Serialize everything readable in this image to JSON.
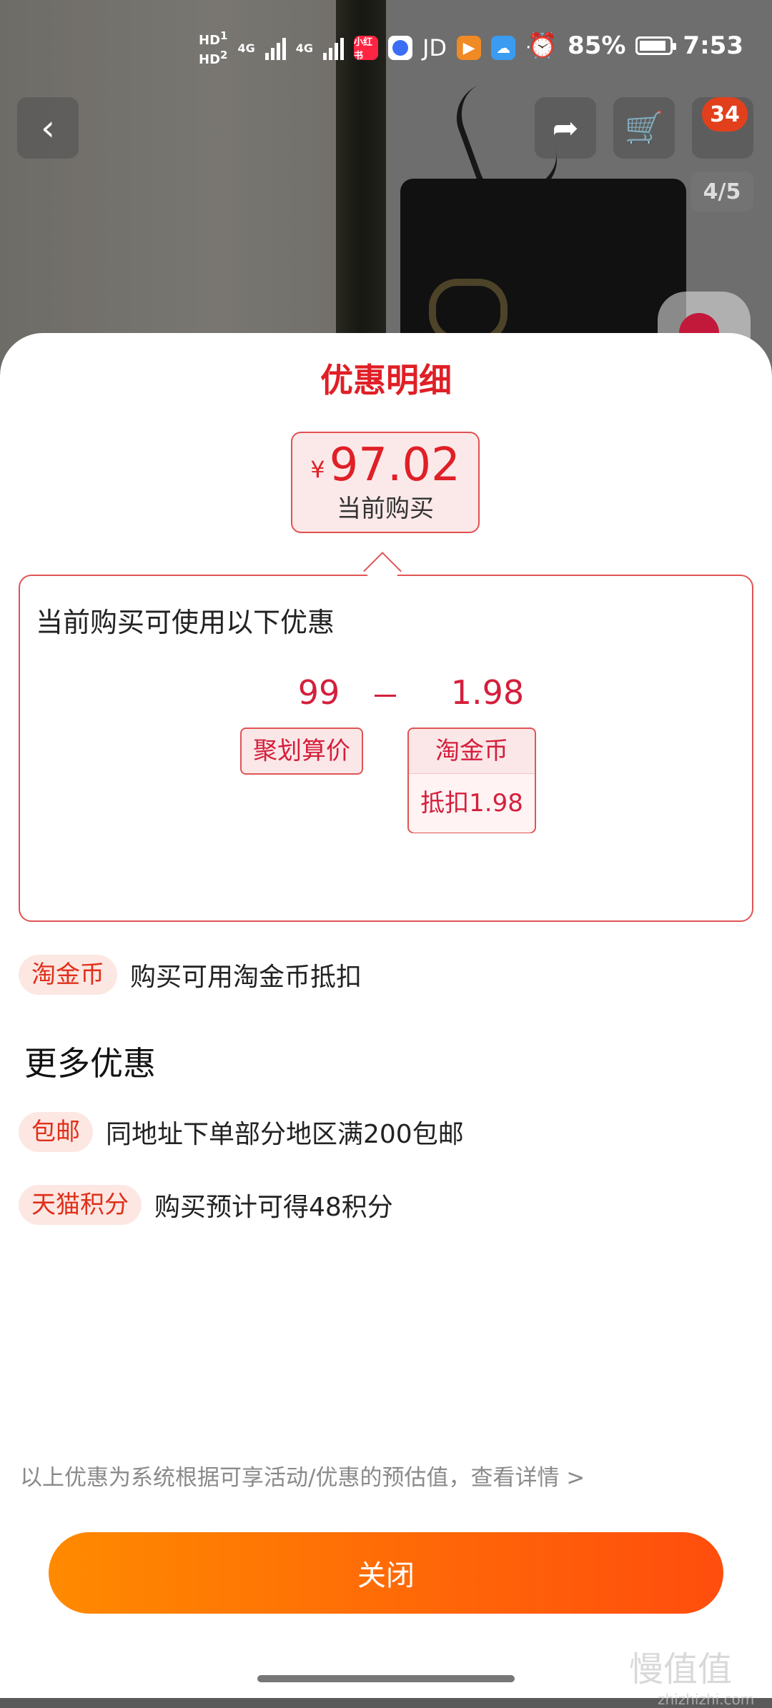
{
  "status_bar": {
    "hd1": "HD",
    "hd1_sub": "1",
    "hd2": "HD",
    "hd2_sub": "2",
    "net1": "4G",
    "net2": "4G",
    "app_red": "小红书",
    "app_jd": "JD",
    "more": "···",
    "battery": "85%",
    "time": "7:53"
  },
  "nav": {
    "cart_badge": "34",
    "pager": "4/5"
  },
  "sheet": {
    "title": "优惠明细",
    "price_symbol": "¥",
    "price": "97.02",
    "price_label": "当前购买",
    "coupon_heading": "当前购买可使用以下优惠",
    "calc": {
      "base_value": "99",
      "base_tag": "聚划算价",
      "discount_value": "1.98",
      "discount_tag_title": "淘金币",
      "discount_tag_sub": "抵扣1.98"
    },
    "taojinbi_row": {
      "tag": "淘金币",
      "text": "购买可用淘金币抵扣"
    },
    "more_title": "更多优惠",
    "more_items": [
      {
        "tag": "包邮",
        "text": "同地址下单部分地区满200包邮"
      },
      {
        "tag": "天猫积分",
        "text": "购买预计可得48积分"
      }
    ],
    "footnote": "以上优惠为系统根据可享活动/优惠的预估值，查看详情 >",
    "close_label": "关闭"
  },
  "watermark": {
    "main": "慢值值",
    "sub": "zhizhizhi.com"
  },
  "colors": {
    "accent_red": "#e01f26",
    "button_start": "#ff8a00",
    "button_end": "#ff4d0d"
  }
}
